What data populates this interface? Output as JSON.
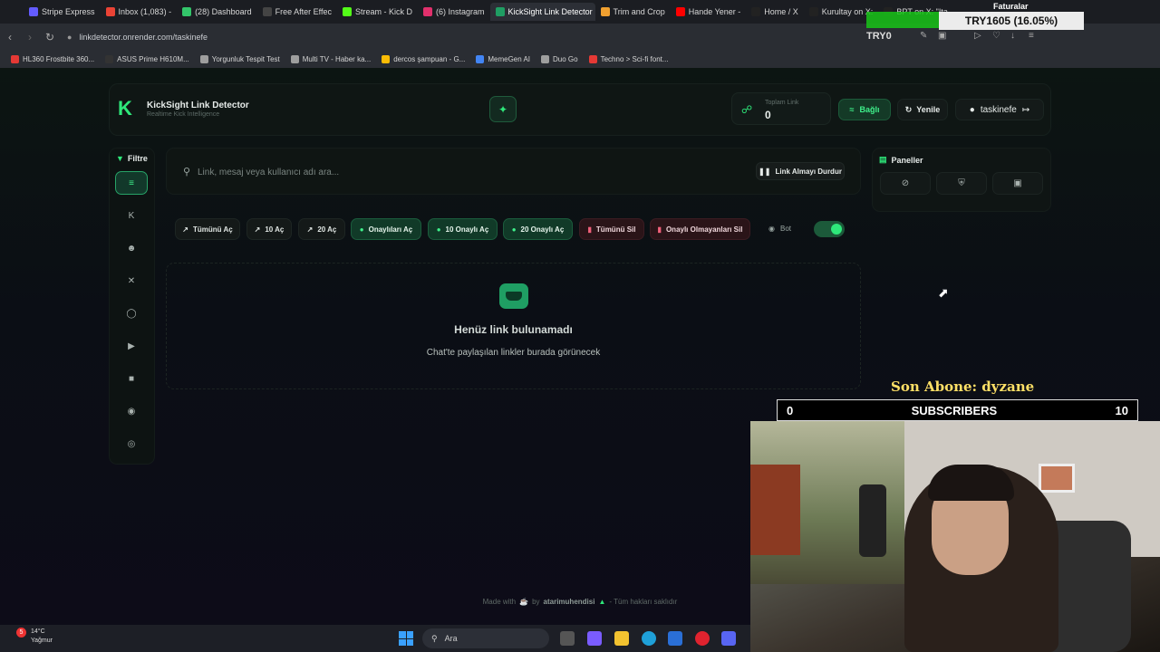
{
  "browser": {
    "tabs": [
      {
        "label": "Stripe Express",
        "color": "#635bff"
      },
      {
        "label": "Inbox (1,083) -",
        "color": "#ea4335"
      },
      {
        "label": "(28) Dashboard",
        "color": "#33c56a"
      },
      {
        "label": "Free After Effec",
        "color": "#444444"
      },
      {
        "label": "Stream - Kick D",
        "color": "#53fc18"
      },
      {
        "label": "(6) Instagram",
        "color": "#e1306c"
      },
      {
        "label": "KickSight Link Detector",
        "color": "#1f9e63"
      },
      {
        "label": "Trim and Crop",
        "color": "#f0a030"
      },
      {
        "label": "Hande Yener -",
        "color": "#ff0000"
      },
      {
        "label": "Home / X",
        "color": "#222222"
      },
      {
        "label": "Kurultay on X:",
        "color": "#222222"
      },
      {
        "label": "BPT on X: \"Ita",
        "color": "#222222"
      }
    ],
    "url": "linkdetector.onrender.com/taskinefe",
    "try_label": "TRY0",
    "bookmarks": [
      {
        "label": "HL360 Frostbite 360...",
        "color": "#e53935"
      },
      {
        "label": "ASUS Prime H610M...",
        "color": "#333333"
      },
      {
        "label": "Yorgunluk Tespit Test",
        "color": "#9e9e9e"
      },
      {
        "label": "Multi TV - Haber ka...",
        "color": "#9e9e9e"
      },
      {
        "label": "dercos şampuan - G...",
        "color": "#fbbc05"
      },
      {
        "label": "MemeGen AI",
        "color": "#4285f4"
      },
      {
        "label": "Duo Go",
        "color": "#9e9e9e"
      },
      {
        "label": "Techno > Sci-fi font...",
        "color": "#e53935"
      }
    ]
  },
  "overlay": {
    "try_percent": "TRY1605 (16.05%)",
    "faturalar": "Faturalar",
    "son_abone": "Son Abone: dyzane",
    "subs_left": "0",
    "subs_label": "SUBSCRIBERS",
    "subs_right": "10"
  },
  "app": {
    "title": "KickSight Link Detector",
    "subtitle": "Realtime Kick Intelligence",
    "stat_label": "Toplam Link",
    "stat_value": "0",
    "connected": "Bağlı",
    "refresh": "Yenile",
    "username": "taskinefe",
    "filter_label": "Filtre",
    "search_placeholder": "Link, mesaj veya kullanıcı adı ara...",
    "stop_label": "Link Almayı Durdur",
    "actions": {
      "open_all": "Tümünü Aç",
      "open_10": "10 Aç",
      "open_20": "20 Aç",
      "open_approved": "Onaylıları Aç",
      "open_10_approved": "10 Onaylı Aç",
      "open_20_approved": "20 Onaylı Aç",
      "delete_all": "Tümünü Sil",
      "delete_unapproved": "Onaylı Olmayanları Sil"
    },
    "bot_label": "Bot",
    "empty_title": "Henüz link bulunamadı",
    "empty_sub": "Chat'te paylaşılan linkler burada görünecek",
    "panels_label": "Paneller",
    "footer": {
      "made_with": "Made with",
      "by": "by",
      "author": "atarimuhendisi",
      "rights": "- Tüm hakları saklıdır"
    }
  },
  "taskbar": {
    "temp": "14°C",
    "weather": "Yağmur",
    "notif": "5",
    "search": "Ara"
  },
  "colors": {
    "accent": "#2ee87a",
    "background": "#0b0e15",
    "danger": "#f0607a"
  }
}
